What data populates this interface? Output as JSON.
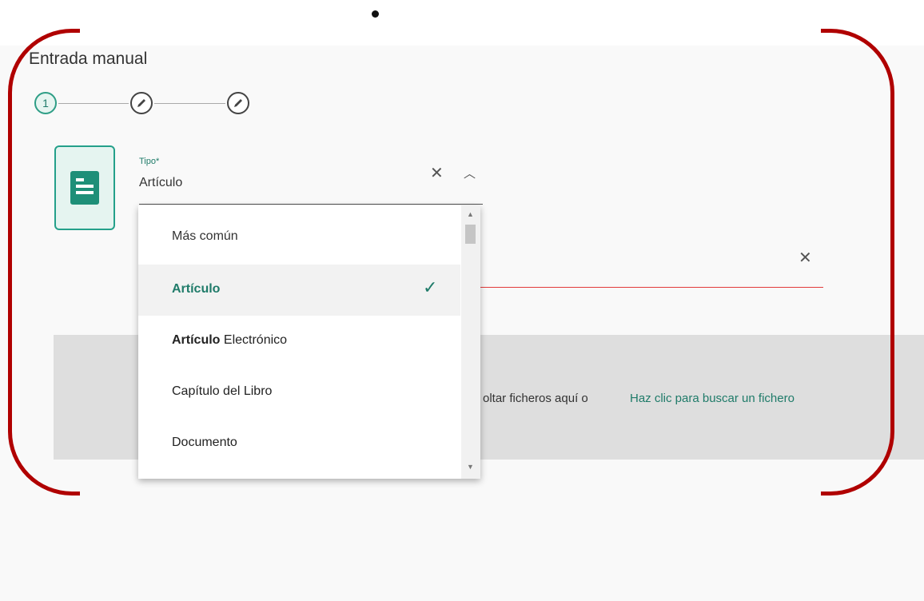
{
  "page": {
    "title": "Entrada manual"
  },
  "stepper": {
    "steps": [
      {
        "label": "1"
      },
      {
        "label": ""
      },
      {
        "label": ""
      }
    ],
    "current": 1
  },
  "type_field": {
    "label": "Tipo*",
    "value": "Artículo",
    "clear_icon": "close-icon",
    "toggle_icon": "chevron-up-icon"
  },
  "type_icon": "document-icon",
  "dropdown": {
    "group_label": "Más común",
    "options": [
      {
        "label": "Artículo",
        "bold": "Artículo",
        "rest": "",
        "selected": true
      },
      {
        "label": "Artículo Electrónico",
        "bold": "Artículo",
        "rest": " Electrónico",
        "selected": false
      },
      {
        "label": "Capítulo del Libro",
        "bold": "",
        "rest": "Capítulo del Libro",
        "selected": false
      },
      {
        "label": "Documento",
        "bold": "",
        "rest": "Documento",
        "selected": false
      }
    ],
    "check_glyph": "✓"
  },
  "dropzone": {
    "text": "oltar ficheros aquí o",
    "link": "Haz clic para buscar un fichero"
  },
  "colors": {
    "accent": "#1f7b69",
    "annotation": "#b00000",
    "error": "#e23b3b"
  }
}
